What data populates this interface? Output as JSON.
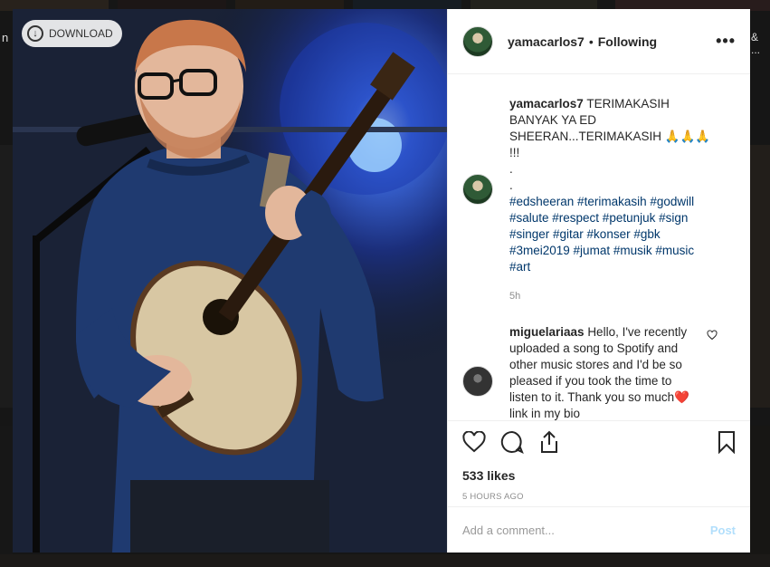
{
  "background": {
    "edge_text_left": "n",
    "edge_text_right": "& ..."
  },
  "photo": {
    "download_label": "DOWNLOAD"
  },
  "header": {
    "username": "yamacarlos7",
    "separator": "•",
    "follow_status": "Following",
    "more_icon": "ellipsis-icon",
    "more_label": "•••"
  },
  "caption": {
    "username": "yamacarlos7",
    "text": "TERIMAKASIH BANYAK YA ED SHEERAN...TERIMAKASIH 🙏🙏🙏 !!!",
    "dot1": ".",
    "dot2": ".",
    "hashtags": "#edsheeran #terimakasih #godwill #salute #respect #petunjuk #sign #singer #gitar #konser #gbk #3mei2019 #jumat #musik #music #art",
    "time": "5h"
  },
  "comment": {
    "username": "miguelariaas",
    "text": "Hello, I've recently uploaded a song to Spotify and other music stores and I'd be so pleased if you took the time to listen to it. Thank you so much❤️ link in my bio"
  },
  "actions": {
    "icons": [
      "heart-icon",
      "comment-icon",
      "share-icon",
      "bookmark-icon"
    ],
    "likes": "533 likes",
    "posted_ago": "5 HOURS AGO"
  },
  "add_comment": {
    "placeholder": "Add a comment...",
    "post_label": "Post"
  }
}
